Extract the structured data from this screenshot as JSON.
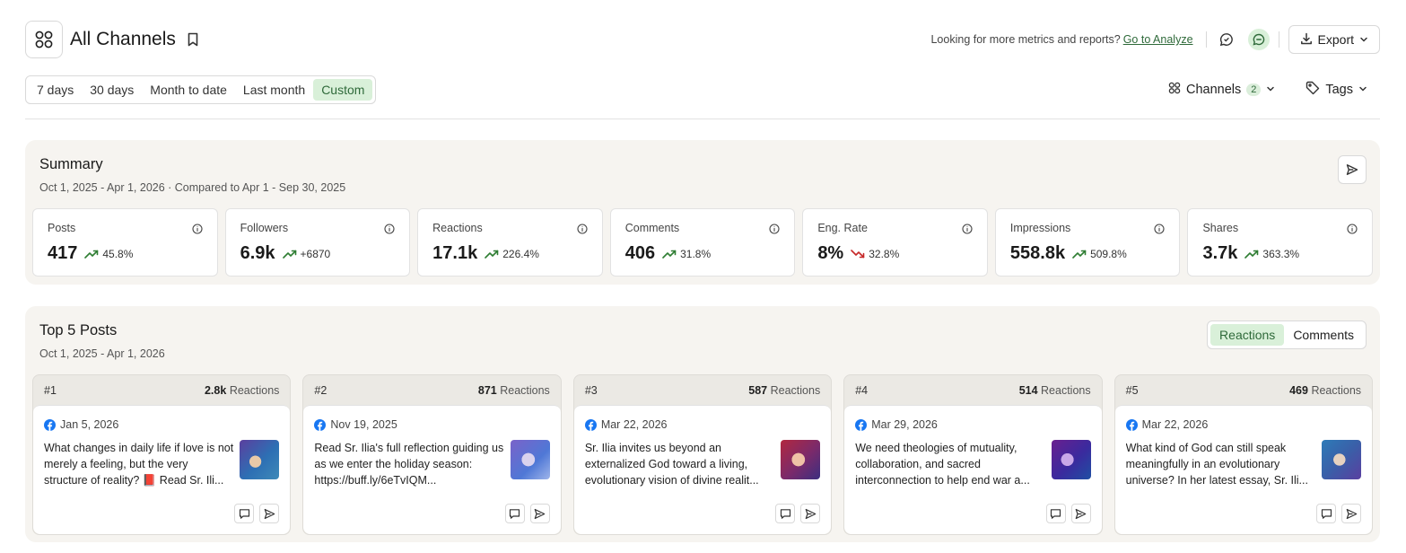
{
  "header": {
    "title": "All Channels",
    "promo_text": "Looking for more metrics and reports?",
    "promo_link": "Go to Analyze",
    "export_label": "Export"
  },
  "date_ranges": [
    {
      "label": "7 days",
      "active": false
    },
    {
      "label": "30 days",
      "active": false
    },
    {
      "label": "Month to date",
      "active": false
    },
    {
      "label": "Last month",
      "active": false
    },
    {
      "label": "Custom",
      "active": true
    }
  ],
  "filters": {
    "channels_label": "Channels",
    "channels_count": "2",
    "tags_label": "Tags"
  },
  "summary": {
    "title": "Summary",
    "subtitle": "Oct 1, 2025 - Apr 1, 2026 · Compared to Apr 1 - Sep 30, 2025",
    "metrics": [
      {
        "label": "Posts",
        "value": "417",
        "change": "45.8%",
        "trend": "up"
      },
      {
        "label": "Followers",
        "value": "6.9k",
        "change": "+6870",
        "trend": "up"
      },
      {
        "label": "Reactions",
        "value": "17.1k",
        "change": "226.4%",
        "trend": "up"
      },
      {
        "label": "Comments",
        "value": "406",
        "change": "31.8%",
        "trend": "up"
      },
      {
        "label": "Eng. Rate",
        "value": "8%",
        "change": "32.8%",
        "trend": "down"
      },
      {
        "label": "Impressions",
        "value": "558.8k",
        "change": "509.8%",
        "trend": "up"
      },
      {
        "label": "Shares",
        "value": "3.7k",
        "change": "363.3%",
        "trend": "up"
      }
    ]
  },
  "top_posts": {
    "title": "Top 5 Posts",
    "subtitle": "Oct 1, 2025 - Apr 1, 2026",
    "toggle": [
      {
        "label": "Reactions",
        "active": true
      },
      {
        "label": "Comments",
        "active": false
      }
    ],
    "metric_word": "Reactions",
    "posts": [
      {
        "rank": "#1",
        "value": "2.8k",
        "date": "Jan 5, 2026",
        "text": "What changes in daily life if love is not merely a feeling, but the very structure of reality? 📕 Read Sr. Ili..."
      },
      {
        "rank": "#2",
        "value": "871",
        "date": "Nov 19, 2025",
        "text": "Read Sr. Ilia's full reflection guiding us as we enter the holiday season: https://buff.ly/6eTvIQM..."
      },
      {
        "rank": "#3",
        "value": "587",
        "date": "Mar 22, 2026",
        "text": "Sr. Ilia invites us beyond an externalized God toward a living, evolutionary vision of divine realit..."
      },
      {
        "rank": "#4",
        "value": "514",
        "date": "Mar 29, 2026",
        "text": "We need theologies of mutuality, collaboration, and sacred interconnection to help end war a..."
      },
      {
        "rank": "#5",
        "value": "469",
        "date": "Mar 22, 2026",
        "text": "What kind of God can still speak meaningfully in an evolutionary universe? In her latest essay, Sr. Ili..."
      }
    ]
  },
  "colors": {
    "accent_green": "#2f6a3a",
    "active_bg": "#d9f0d9",
    "trend_up": "#2e7d32",
    "trend_down": "#c62828",
    "facebook_blue": "#1877f2"
  }
}
